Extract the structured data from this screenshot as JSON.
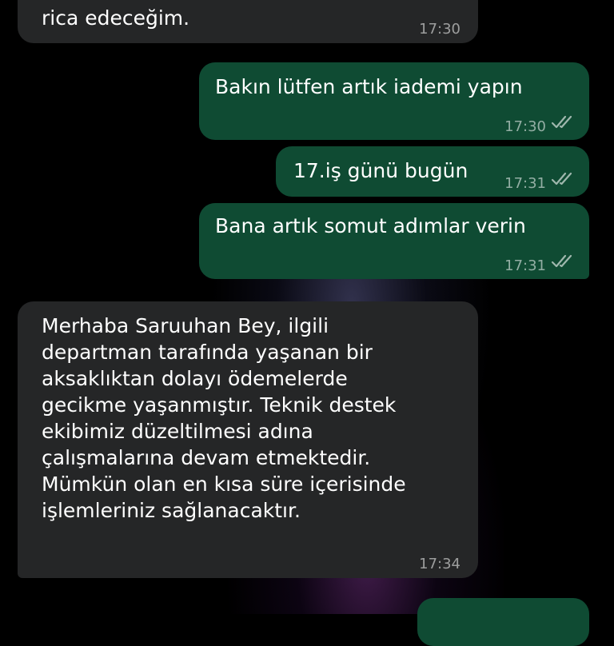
{
  "chat": {
    "messages": [
      {
        "direction": "in",
        "text": "rica edeceğim.",
        "time": "17:30"
      },
      {
        "direction": "out",
        "text": "Bakın lütfen artık iademi yapın",
        "time": "17:30",
        "status": "read"
      },
      {
        "direction": "out",
        "text": "17.iş günü bugün",
        "time": "17:31",
        "status": "read"
      },
      {
        "direction": "out",
        "text": "Bana artık somut adımlar verin",
        "time": "17:31",
        "status": "read"
      },
      {
        "direction": "in",
        "lines": [
          "Merhaba Saruuhan Bey, ilgili",
          "departman tarafında yaşanan bir",
          "aksaklıktan dolayı ödemelerde",
          "gecikme yaşanmıştır. Teknik destek",
          "ekibimiz düzeltilmesi adına",
          "çalışmalarına devam etmektedir.",
          "Mümkün olan en kısa süre içerisinde",
          "işlemleriniz sağlanacaktır."
        ],
        "time": "17:34"
      }
    ]
  },
  "colors": {
    "background": "#000000",
    "incoming_bubble": "#252627",
    "outgoing_bubble": "#0f4b33",
    "timestamp": "#8c8c8c"
  },
  "icons": {
    "read_receipt": "double-check-icon"
  }
}
